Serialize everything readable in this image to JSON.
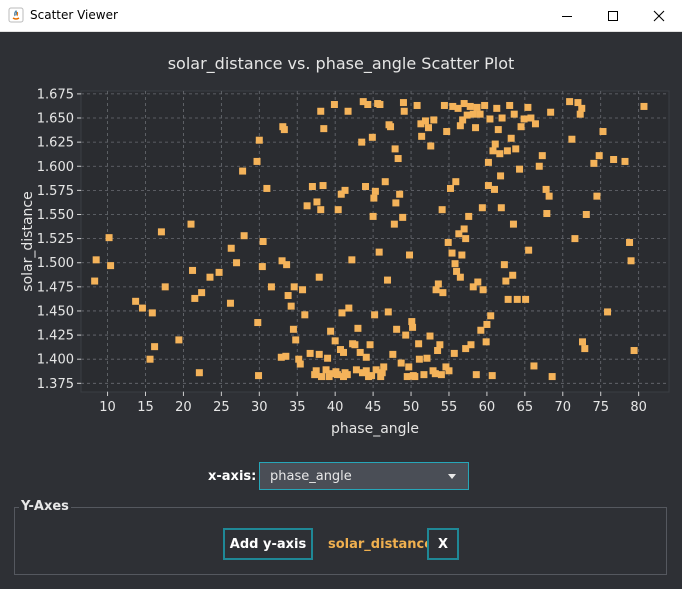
{
  "window": {
    "title": "Scatter Viewer"
  },
  "controls": {
    "x_axis_label": "x-axis:",
    "x_axis_value": "phase_angle",
    "y_axes_group_title": "Y-Axes",
    "add_y_axis_label": "Add y-axis",
    "series_name": "solar_distance",
    "remove_label": "X"
  },
  "colors": {
    "point": "#f4b35a",
    "plot_bg": "#2a2c30",
    "accent": "#27a6b8"
  },
  "chart_data": {
    "type": "scatter",
    "title": "solar_distance vs. phase_angle Scatter Plot",
    "xlabel": "phase_angle",
    "ylabel": "solar_distance",
    "xlim": [
      6.5,
      84
    ],
    "ylim": [
      1.366,
      1.678
    ],
    "xticks": [
      10,
      15,
      20,
      25,
      30,
      35,
      40,
      45,
      50,
      55,
      60,
      65,
      70,
      75,
      80
    ],
    "yticks": [
      1.375,
      1.4,
      1.425,
      1.45,
      1.475,
      1.5,
      1.525,
      1.55,
      1.575,
      1.6,
      1.625,
      1.65,
      1.675
    ],
    "ytick_labels": [
      "1.375",
      "1.400",
      "1.425",
      "1.450",
      "1.475",
      "1.500",
      "1.525",
      "1.550",
      "1.575",
      "1.600",
      "1.625",
      "1.650",
      "1.675"
    ],
    "grid": true,
    "series": [
      {
        "points": [
          [
            8.3,
            1.481
          ],
          [
            8.5,
            1.503
          ],
          [
            10.2,
            1.526
          ],
          [
            10.4,
            1.497
          ],
          [
            13.7,
            1.46
          ],
          [
            14.6,
            1.453
          ],
          [
            15.6,
            1.4
          ],
          [
            15.9,
            1.448
          ],
          [
            16.2,
            1.413
          ],
          [
            17.1,
            1.532
          ],
          [
            17.6,
            1.475
          ],
          [
            19.4,
            1.42
          ],
          [
            21.0,
            1.54
          ],
          [
            21.2,
            1.492
          ],
          [
            21.5,
            1.463
          ],
          [
            22.1,
            1.386
          ],
          [
            22.4,
            1.469
          ],
          [
            23.5,
            1.485
          ],
          [
            24.7,
            1.49
          ],
          [
            26.2,
            1.458
          ],
          [
            26.3,
            1.515
          ],
          [
            27.0,
            1.5
          ],
          [
            27.8,
            1.595
          ],
          [
            28.0,
            1.528
          ],
          [
            29.7,
            1.605
          ],
          [
            29.8,
            1.438
          ],
          [
            29.9,
            1.383
          ],
          [
            30.0,
            1.627
          ],
          [
            30.4,
            1.496
          ],
          [
            30.5,
            1.522
          ],
          [
            31.0,
            1.577
          ],
          [
            31.6,
            1.475
          ],
          [
            32.9,
            1.402
          ],
          [
            33.0,
            1.502
          ],
          [
            33.1,
            1.641
          ],
          [
            33.3,
            1.638
          ],
          [
            33.5,
            1.403
          ],
          [
            33.6,
            1.498
          ],
          [
            33.8,
            1.466
          ],
          [
            34.2,
            1.455
          ],
          [
            34.5,
            1.431
          ],
          [
            34.6,
            1.475
          ],
          [
            34.8,
            1.42
          ],
          [
            35.2,
            1.4
          ],
          [
            35.4,
            1.395
          ],
          [
            35.7,
            1.472
          ],
          [
            36.0,
            1.446
          ],
          [
            36.3,
            1.559
          ],
          [
            36.7,
            1.406
          ],
          [
            37.0,
            1.579
          ],
          [
            37.3,
            1.384
          ],
          [
            37.5,
            1.388
          ],
          [
            37.6,
            1.563
          ],
          [
            37.9,
            1.485
          ],
          [
            37.9,
            1.405
          ],
          [
            38.1,
            1.555
          ],
          [
            38.1,
            1.657
          ],
          [
            38.2,
            1.382
          ],
          [
            38.4,
            1.58
          ],
          [
            38.5,
            1.639
          ],
          [
            38.8,
            1.389
          ],
          [
            39.0,
            1.401
          ],
          [
            39.2,
            1.382
          ],
          [
            39.4,
            1.429
          ],
          [
            39.7,
            1.385
          ],
          [
            39.9,
            1.664
          ],
          [
            40.0,
            1.419
          ],
          [
            40.1,
            1.387
          ],
          [
            40.3,
            1.384
          ],
          [
            40.4,
            1.555
          ],
          [
            40.7,
            1.41
          ],
          [
            40.8,
            1.571
          ],
          [
            40.9,
            1.448
          ],
          [
            41.1,
            1.407
          ],
          [
            41.1,
            1.382
          ],
          [
            41.3,
            1.575
          ],
          [
            41.3,
            1.386
          ],
          [
            41.6,
            1.384
          ],
          [
            41.7,
            1.657
          ],
          [
            41.8,
            1.453
          ],
          [
            42.2,
            1.503
          ],
          [
            42.3,
            1.416
          ],
          [
            42.6,
            1.415
          ],
          [
            42.8,
            1.389
          ],
          [
            43.0,
            1.432
          ],
          [
            43.3,
            1.407
          ],
          [
            43.5,
            1.625
          ],
          [
            43.6,
            1.386
          ],
          [
            43.7,
            1.667
          ],
          [
            44.0,
            1.579
          ],
          [
            44.1,
            1.402
          ],
          [
            44.1,
            1.388
          ],
          [
            44.3,
            1.664
          ],
          [
            44.4,
            1.382
          ],
          [
            44.6,
            1.415
          ],
          [
            44.8,
            1.383
          ],
          [
            44.9,
            1.63
          ],
          [
            45.0,
            1.548
          ],
          [
            45.1,
            1.567
          ],
          [
            45.2,
            1.446
          ],
          [
            45.3,
            1.574
          ],
          [
            45.4,
            1.389
          ],
          [
            45.6,
            1.665
          ],
          [
            45.8,
            1.511
          ],
          [
            45.9,
            1.664
          ],
          [
            46.0,
            1.382
          ],
          [
            46.2,
            1.386
          ],
          [
            46.4,
            1.392
          ],
          [
            46.6,
            1.584
          ],
          [
            46.9,
            1.482
          ],
          [
            47.0,
            1.449
          ],
          [
            47.1,
            1.643
          ],
          [
            47.3,
            1.641
          ],
          [
            47.6,
            1.405
          ],
          [
            47.8,
            1.54
          ],
          [
            47.9,
            1.618
          ],
          [
            48.0,
            1.562
          ],
          [
            48.1,
            1.431
          ],
          [
            48.3,
            1.608
          ],
          [
            48.5,
            1.571
          ],
          [
            48.7,
            1.396
          ],
          [
            48.9,
            1.547
          ],
          [
            49.0,
            1.666
          ],
          [
            49.1,
            1.657
          ],
          [
            49.3,
            1.425
          ],
          [
            49.5,
            1.382
          ],
          [
            49.7,
            1.392
          ],
          [
            49.8,
            1.508
          ],
          [
            50.1,
            1.439
          ],
          [
            50.2,
            1.433
          ],
          [
            50.3,
            1.383
          ],
          [
            50.5,
            1.382
          ],
          [
            50.8,
            1.663
          ],
          [
            51.0,
            1.416
          ],
          [
            51.1,
            1.4
          ],
          [
            51.3,
            1.644
          ],
          [
            51.4,
            1.631
          ],
          [
            51.7,
            1.384
          ],
          [
            51.9,
            1.647
          ],
          [
            52.1,
            1.401
          ],
          [
            52.3,
            1.64
          ],
          [
            52.5,
            1.424
          ],
          [
            52.6,
            1.621
          ],
          [
            52.9,
            1.388
          ],
          [
            53.0,
            1.648
          ],
          [
            53.2,
            1.385
          ],
          [
            53.3,
            1.472
          ],
          [
            53.5,
            1.409
          ],
          [
            53.6,
            1.478
          ],
          [
            53.8,
            1.415
          ],
          [
            54.0,
            1.384
          ],
          [
            54.1,
            1.555
          ],
          [
            54.2,
            1.469
          ],
          [
            54.4,
            1.663
          ],
          [
            54.6,
            1.392
          ],
          [
            54.7,
            1.636
          ],
          [
            54.9,
            1.521
          ],
          [
            55.0,
            1.388
          ],
          [
            55.2,
            1.577
          ],
          [
            55.4,
            1.51
          ],
          [
            55.5,
            1.662
          ],
          [
            55.7,
            1.406
          ],
          [
            55.8,
            1.499
          ],
          [
            55.9,
            1.584
          ],
          [
            56.0,
            1.491
          ],
          [
            56.2,
            1.66
          ],
          [
            56.3,
            1.53
          ],
          [
            56.5,
            1.485
          ],
          [
            56.5,
            1.642
          ],
          [
            56.7,
            1.508
          ],
          [
            56.8,
            1.648
          ],
          [
            57.0,
            1.535
          ],
          [
            57.0,
            1.665
          ],
          [
            57.2,
            1.525
          ],
          [
            57.2,
            1.411
          ],
          [
            57.4,
            1.653
          ],
          [
            57.6,
            1.548
          ],
          [
            57.8,
            1.662
          ],
          [
            57.9,
            1.415
          ],
          [
            58.2,
            1.475
          ],
          [
            58.2,
            1.654
          ],
          [
            58.5,
            1.64
          ],
          [
            58.6,
            1.384
          ],
          [
            58.7,
            1.661
          ],
          [
            58.8,
            1.48
          ],
          [
            59.1,
            1.654
          ],
          [
            59.2,
            1.43
          ],
          [
            59.4,
            1.557
          ],
          [
            59.5,
            1.472
          ],
          [
            59.7,
            1.663
          ],
          [
            59.9,
            1.418
          ],
          [
            60.0,
            1.436
          ],
          [
            60.2,
            1.58
          ],
          [
            60.2,
            1.604
          ],
          [
            60.4,
            1.649
          ],
          [
            60.5,
            1.445
          ],
          [
            60.7,
            1.383
          ],
          [
            60.8,
            1.616
          ],
          [
            61.0,
            1.576
          ],
          [
            61.1,
            1.623
          ],
          [
            61.3,
            1.66
          ],
          [
            61.5,
            1.638
          ],
          [
            61.7,
            1.613
          ],
          [
            61.8,
            1.59
          ],
          [
            61.9,
            1.557
          ],
          [
            62.0,
            1.65
          ],
          [
            62.3,
            1.498
          ],
          [
            62.5,
            1.481
          ],
          [
            62.7,
            1.616
          ],
          [
            62.8,
            1.462
          ],
          [
            63.0,
            1.663
          ],
          [
            63.2,
            1.629
          ],
          [
            63.4,
            1.487
          ],
          [
            63.5,
            1.54
          ],
          [
            63.6,
            1.654
          ],
          [
            63.8,
            1.618
          ],
          [
            64.0,
            1.462
          ],
          [
            64.3,
            1.597
          ],
          [
            64.5,
            1.641
          ],
          [
            64.9,
            1.649
          ],
          [
            65.1,
            1.462
          ],
          [
            65.4,
            1.661
          ],
          [
            65.5,
            1.513
          ],
          [
            65.8,
            1.65
          ],
          [
            66.2,
            1.393
          ],
          [
            66.4,
            1.644
          ],
          [
            66.9,
            1.6
          ],
          [
            67.3,
            1.611
          ],
          [
            67.8,
            1.576
          ],
          [
            67.9,
            1.551
          ],
          [
            68.2,
            1.569
          ],
          [
            68.4,
            1.656
          ],
          [
            68.6,
            1.382
          ],
          [
            70.9,
            1.667
          ],
          [
            71.2,
            1.628
          ],
          [
            71.6,
            1.525
          ],
          [
            72.0,
            1.666
          ],
          [
            72.3,
            1.654
          ],
          [
            72.5,
            1.66
          ],
          [
            72.6,
            1.418
          ],
          [
            72.9,
            1.411
          ],
          [
            73.1,
            1.55
          ],
          [
            74.1,
            1.603
          ],
          [
            74.5,
            1.569
          ],
          [
            74.8,
            1.611
          ],
          [
            75.3,
            1.636
          ],
          [
            75.9,
            1.449
          ],
          [
            76.7,
            1.607
          ],
          [
            78.2,
            1.605
          ],
          [
            78.8,
            1.521
          ],
          [
            79.0,
            1.502
          ],
          [
            79.4,
            1.409
          ],
          [
            80.7,
            1.662
          ]
        ]
      }
    ]
  }
}
